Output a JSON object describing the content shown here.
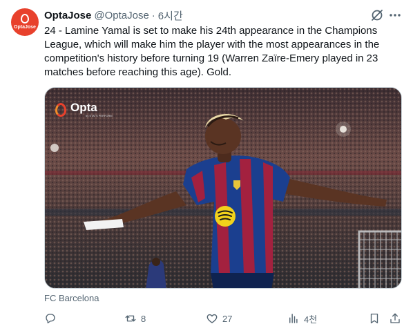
{
  "author": {
    "name": "OptaJose",
    "handle": "@OptaJose",
    "separator": "·",
    "time": "6시간",
    "avatar_text": "OptaJose"
  },
  "tweet": {
    "text": "24 - Lamine Yamal is set to make his 24th appearance in the Champions League, which will make him the player with the most appearances in the competition's history before turning 19 (Warren Zaïre-Emery played in 23 matches before reaching this age). Gold."
  },
  "media": {
    "watermark": "Opta",
    "watermark_sub": "by STATS PERFORM",
    "alt": "Lamine Yamal celebrating in FC Barcelona kit"
  },
  "caption": "FC Barcelona",
  "actions": {
    "reply": {
      "icon": "reply-icon",
      "count": ""
    },
    "retweet": {
      "icon": "retweet-icon",
      "count": "8"
    },
    "like": {
      "icon": "heart-icon",
      "count": "27"
    },
    "views": {
      "icon": "views-icon",
      "count": "4천"
    },
    "bookmark": {
      "icon": "bookmark-icon"
    },
    "share": {
      "icon": "share-icon"
    }
  },
  "colors": {
    "avatar_bg": "#e8412c",
    "muted": "#536471",
    "text": "#0f1419",
    "barca_blue": "#1b3f8f",
    "barca_red": "#a3213f"
  }
}
